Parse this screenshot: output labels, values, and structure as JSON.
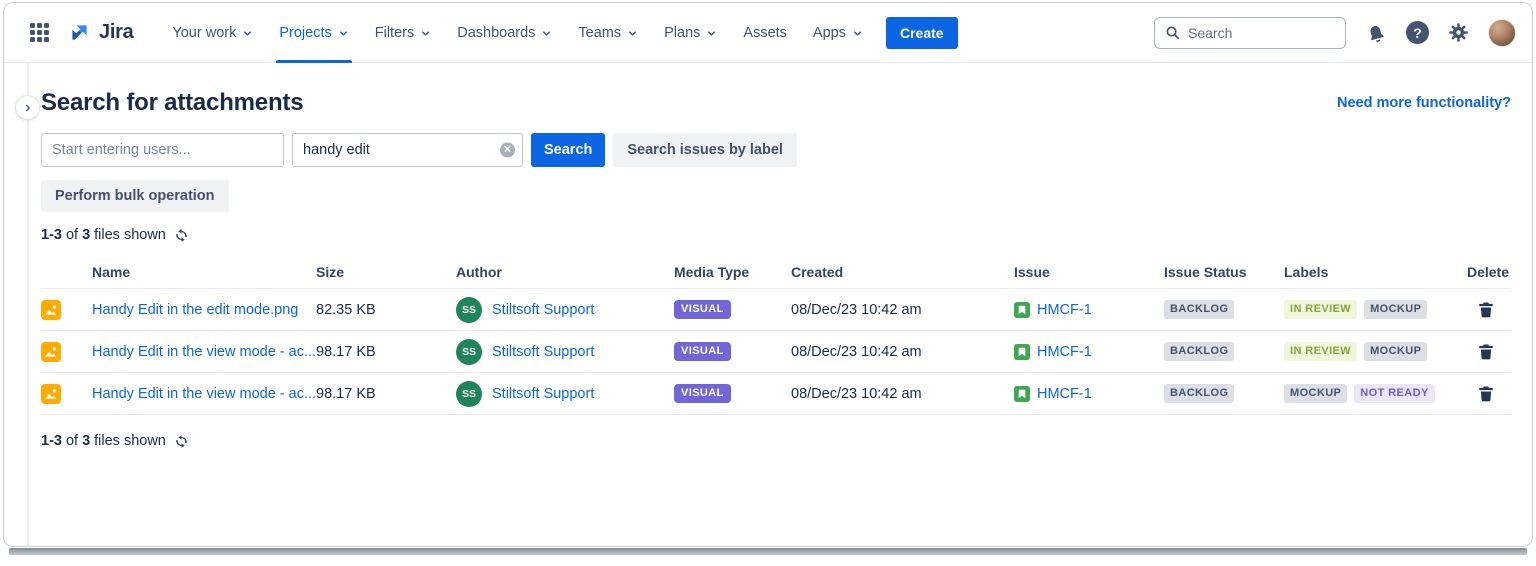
{
  "navbar": {
    "logo_text": "Jira",
    "items": [
      {
        "label": "Your work",
        "dropdown": true,
        "active": false
      },
      {
        "label": "Projects",
        "dropdown": true,
        "active": true
      },
      {
        "label": "Filters",
        "dropdown": true,
        "active": false
      },
      {
        "label": "Dashboards",
        "dropdown": true,
        "active": false
      },
      {
        "label": "Teams",
        "dropdown": true,
        "active": false
      },
      {
        "label": "Plans",
        "dropdown": true,
        "active": false
      },
      {
        "label": "Assets",
        "dropdown": false,
        "active": false
      },
      {
        "label": "Apps",
        "dropdown": true,
        "active": false
      }
    ],
    "create_label": "Create",
    "search_placeholder": "Search",
    "icons": [
      "app-switcher-grid",
      "notification-bell",
      "help-question-circle",
      "settings-gear",
      "user-avatar"
    ]
  },
  "page": {
    "title": "Search for attachments",
    "need_more_link": "Need more functionality?"
  },
  "filters": {
    "users_placeholder": "Start entering users...",
    "query_value": "handy edit",
    "clear_icon": "circle-x",
    "search_button": "Search",
    "search_by_label_button": "Search issues by label",
    "bulk_button": "Perform bulk operation"
  },
  "results": {
    "range": "1-3",
    "of_text": "of",
    "total": "3",
    "suffix": "files shown",
    "refresh_icon": "sync-arrows"
  },
  "table": {
    "headers": [
      "Name",
      "Size",
      "Author",
      "Media Type",
      "Created",
      "Issue",
      "Issue Status",
      "Labels",
      "Delete"
    ],
    "rows": [
      {
        "file_icon": "image-file",
        "name": "Handy Edit in the edit mode.png",
        "size": "82.35 KB",
        "author_initials": "SS",
        "author": "Stiltsoft Support",
        "media_type": "VISUAL",
        "created": "08/Dec/23 10:42 am",
        "issue_icon": "story-bookmark",
        "issue": "HMCF-1",
        "issue_status": "BACKLOG",
        "labels": [
          {
            "text": "IN REVIEW",
            "variant": "green"
          },
          {
            "text": "MOCKUP",
            "variant": "gray"
          }
        ],
        "delete_icon": "trash"
      },
      {
        "file_icon": "image-file",
        "name": "Handy Edit in the view mode - ac...",
        "size": "98.17 KB",
        "author_initials": "SS",
        "author": "Stiltsoft Support",
        "media_type": "VISUAL",
        "created": "08/Dec/23 10:42 am",
        "issue_icon": "story-bookmark",
        "issue": "HMCF-1",
        "issue_status": "BACKLOG",
        "labels": [
          {
            "text": "IN REVIEW",
            "variant": "green"
          },
          {
            "text": "MOCKUP",
            "variant": "gray"
          }
        ],
        "delete_icon": "trash"
      },
      {
        "file_icon": "image-file",
        "name": "Handy Edit in the view mode - ac...",
        "size": "98.17 KB",
        "author_initials": "SS",
        "author": "Stiltsoft Support",
        "media_type": "VISUAL",
        "created": "08/Dec/23 10:42 am",
        "issue_icon": "story-bookmark",
        "issue": "HMCF-1",
        "issue_status": "BACKLOG",
        "labels": [
          {
            "text": "MOCKUP",
            "variant": "gray"
          },
          {
            "text": "NOT READY",
            "variant": "purple"
          }
        ],
        "delete_icon": "trash"
      }
    ]
  },
  "colors": {
    "accent_blue": "#0C66E4",
    "heading_navy": "#172B4D",
    "nav_text": "#44546F",
    "visual_badge_purple": "#7265D8",
    "status_lozenge_bg": "#DCDFE4",
    "label_green_text": "#84A83D",
    "label_purple_text": "#6E5DC6",
    "avatar_green": "#1F845A",
    "file_icon_orange": "#FFAB00",
    "issue_icon_green": "#3DA751"
  }
}
